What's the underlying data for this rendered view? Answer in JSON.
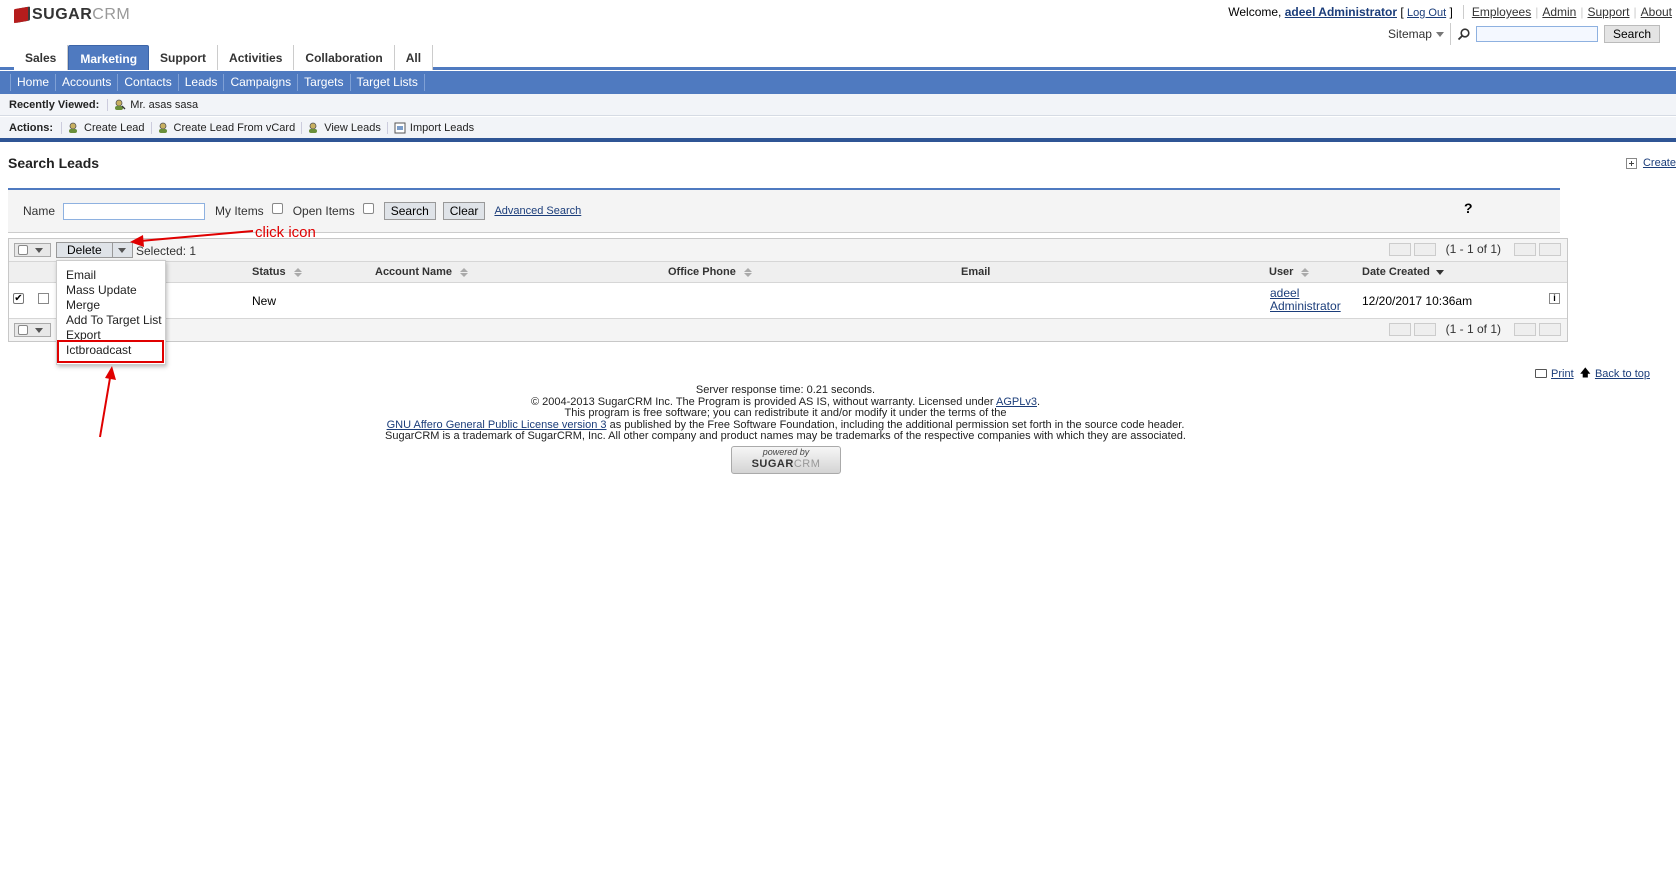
{
  "brand": {
    "logo_main": "SUGAR",
    "logo_accent": "CRM"
  },
  "header": {
    "welcome_prefix": "Welcome,",
    "user_name": "adeel Administrator",
    "logout_open": "[",
    "logout": "Log Out",
    "logout_close": "]",
    "links": [
      "Employees",
      "Admin",
      "Support",
      "About"
    ],
    "sitemap": "Sitemap",
    "search_placeholder": "",
    "search_button": "Search"
  },
  "module_tabs": [
    "Sales",
    "Marketing",
    "Support",
    "Activities",
    "Collaboration",
    "All"
  ],
  "active_tab": "Marketing",
  "sub_tabs": [
    "Home",
    "Accounts",
    "Contacts",
    "Leads",
    "Campaigns",
    "Targets",
    "Target Lists"
  ],
  "recently_viewed": {
    "label": "Recently Viewed:",
    "items": [
      "Mr. asas sasa"
    ]
  },
  "actions": {
    "label": "Actions:",
    "items": [
      "Create Lead",
      "Create Lead From vCard",
      "View Leads",
      "Import Leads"
    ]
  },
  "page": {
    "title": "Search Leads",
    "create": "Create"
  },
  "search_form": {
    "name_label": "Name",
    "name_value": "",
    "my_items_label": "My Items",
    "open_items_label": "Open Items",
    "search_button": "Search",
    "clear_button": "Clear",
    "advanced_link": "Advanced Search",
    "help": "?"
  },
  "list": {
    "delete_button": "Delete",
    "selected_text": "Selected: 1",
    "pager_text": "(1 - 1 of 1)",
    "columns": [
      "Status",
      "Account Name",
      "Office Phone",
      "Email",
      "User",
      "Date Created"
    ],
    "rows": [
      {
        "status": "New",
        "account_name": "",
        "office_phone": "",
        "email": "",
        "user_line1": "adeel",
        "user_line2": "Administrator",
        "date_created": "12/20/2017 10:36am"
      }
    ]
  },
  "bulk_menu": [
    "Email",
    "Mass Update",
    "Merge",
    "Add To Target List",
    "Export",
    "Ictbroadcast"
  ],
  "annotation": {
    "text": "click icon",
    "color": "#e00000"
  },
  "footer": {
    "print": "Print",
    "back_to_top": "Back to top",
    "line1": "Server response time: 0.21 seconds.",
    "line2_prefix": "© 2004-2013 SugarCRM Inc. The Program is provided AS IS, without warranty. Licensed under",
    "line2_link": "AGPLv3",
    "line2_suffix": ".",
    "line3": "This program is free software; you can redistribute it and/or modify it under the terms of the",
    "line4_link": "GNU Affero General Public License version 3",
    "line4_suffix": "as published by the Free Software Foundation, including the additional permission set forth in the source code header.",
    "line5": "SugarCRM is a trademark of SugarCRM, Inc. All other company and product names may be trademarks of the respective companies with which they are associated.",
    "powered_by": "powered by"
  },
  "colors": {
    "accent": "#4f7ac0",
    "accent_dark": "#2f5595",
    "link": "#1b3d7a",
    "annotation": "#e00000"
  }
}
